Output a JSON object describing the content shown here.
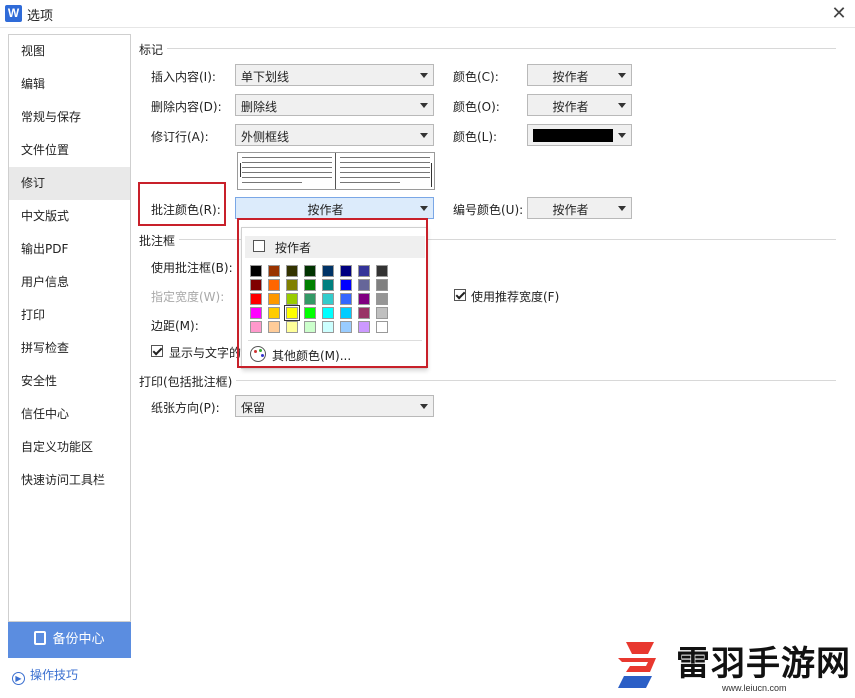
{
  "window": {
    "app_icon": "W",
    "title": "选项",
    "close_symbol": "✕"
  },
  "sidebar": {
    "items": [
      {
        "label": "视图"
      },
      {
        "label": "编辑"
      },
      {
        "label": "常规与保存"
      },
      {
        "label": "文件位置"
      },
      {
        "label": "修订",
        "active": true
      },
      {
        "label": "中文版式"
      },
      {
        "label": "输出PDF"
      },
      {
        "label": "用户信息"
      },
      {
        "label": "打印"
      },
      {
        "label": "拼写检查"
      },
      {
        "label": "安全性"
      },
      {
        "label": "信任中心"
      },
      {
        "label": "自定义功能区"
      },
      {
        "label": "快速访问工具栏"
      }
    ],
    "backup_label": "备份中心",
    "tips_label": "操作技巧"
  },
  "marks": {
    "section_title": "标记",
    "insert_label": "插入内容(I):",
    "insert_value": "单下划线",
    "insert_color_label": "颜色(C):",
    "insert_color_value": "按作者",
    "delete_label": "删除内容(D):",
    "delete_value": "删除线",
    "delete_color_label": "颜色(O):",
    "delete_color_value": "按作者",
    "revline_label": "修订行(A):",
    "revline_value": "外侧框线",
    "revline_color_label": "颜色(L):",
    "revline_color_value": "#000000",
    "comment_color_label": "批注颜色(R):",
    "comment_color_value": "按作者",
    "number_color_label": "编号颜色(U):",
    "number_color_value": "按作者"
  },
  "balloons": {
    "section_title": "批注框",
    "use_label": "使用批注框(B):",
    "width_label": "指定宽度(W):",
    "recommend_label": "使用推荐宽度(F)",
    "recommend_checked": true,
    "margin_label": "边距(M):",
    "show_lines_label": "显示与文字的",
    "show_lines_checked": true
  },
  "printing": {
    "section_title": "打印(包括批注框)",
    "orientation_label": "纸张方向(P):",
    "orientation_value": "保留"
  },
  "color_dropdown": {
    "by_author_label": "按作者",
    "more_colors_label": "其他颜色(M)...",
    "selected": "#ffff00",
    "swatches": [
      [
        "#000000",
        "#993300",
        "#333300",
        "#003300",
        "#003366",
        "#000080",
        "#333399",
        "#333333"
      ],
      [
        "#800000",
        "#ff6600",
        "#808000",
        "#008000",
        "#008080",
        "#0000ff",
        "#666699",
        "#808080"
      ],
      [
        "#ff0000",
        "#ff9900",
        "#99cc00",
        "#339966",
        "#33cccc",
        "#3366ff",
        "#800080",
        "#969696"
      ],
      [
        "#ff00ff",
        "#ffcc00",
        "#ffff00",
        "#00ff00",
        "#00ffff",
        "#00ccff",
        "#993366",
        "#c0c0c0"
      ],
      [
        "#ff99cc",
        "#ffcc99",
        "#ffff99",
        "#ccffcc",
        "#ccffff",
        "#99ccff",
        "#cc99ff",
        "#ffffff"
      ]
    ]
  },
  "watermark": {
    "main": "雷羽手游网",
    "url": "www.leiucn.com"
  },
  "colors": {
    "accent": "#5b8de0",
    "highlight": "#c8202a",
    "brand_red": "#e8382f",
    "brand_blue": "#2b5fc6"
  }
}
